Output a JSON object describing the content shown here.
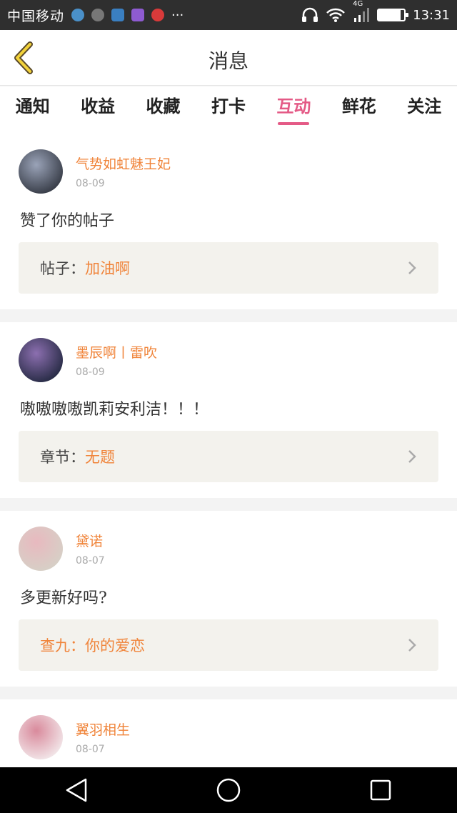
{
  "status_bar": {
    "carrier": "中国移动",
    "more": "···",
    "network": "4G",
    "time": "13:31",
    "battery_level": 0.85
  },
  "header": {
    "title": "消息"
  },
  "tabs": [
    {
      "label": "通知",
      "active": false
    },
    {
      "label": "收益",
      "active": false
    },
    {
      "label": "收藏",
      "active": false
    },
    {
      "label": "打卡",
      "active": false
    },
    {
      "label": "互动",
      "active": true
    },
    {
      "label": "鲜花",
      "active": false
    },
    {
      "label": "关注",
      "active": false
    }
  ],
  "messages": [
    {
      "username": "气势如虹魅王妃",
      "date": "08-09",
      "content": "赞了你的帖子",
      "ref_type": "帖子：",
      "ref_title": "加油啊",
      "avatar_colors": [
        "#3a3f4a",
        "#9aa3b8"
      ]
    },
    {
      "username": "墨辰啊丨雷吹",
      "date": "08-09",
      "content": "嗷嗷嗷嗷凯莉安利洁！！！",
      "ref_type": "章节：",
      "ref_title": "无题",
      "avatar_colors": [
        "#2a2d48",
        "#8c6fb0"
      ]
    },
    {
      "username": "黛诺",
      "date": "08-07",
      "content": "多更新好吗?",
      "ref_type": "查九：",
      "ref_title": "你的爱恋",
      "avatar_colors": [
        "#d7cfc6",
        "#e8b9bf"
      ]
    },
    {
      "username": "翼羽相生",
      "date": "08-07",
      "avatar_colors": [
        "#f1e3e6",
        "#d98a9c"
      ]
    }
  ],
  "colors": {
    "accent": "#e45a86",
    "username": "#f0843a",
    "ref_bg": "#f3f2ed"
  }
}
